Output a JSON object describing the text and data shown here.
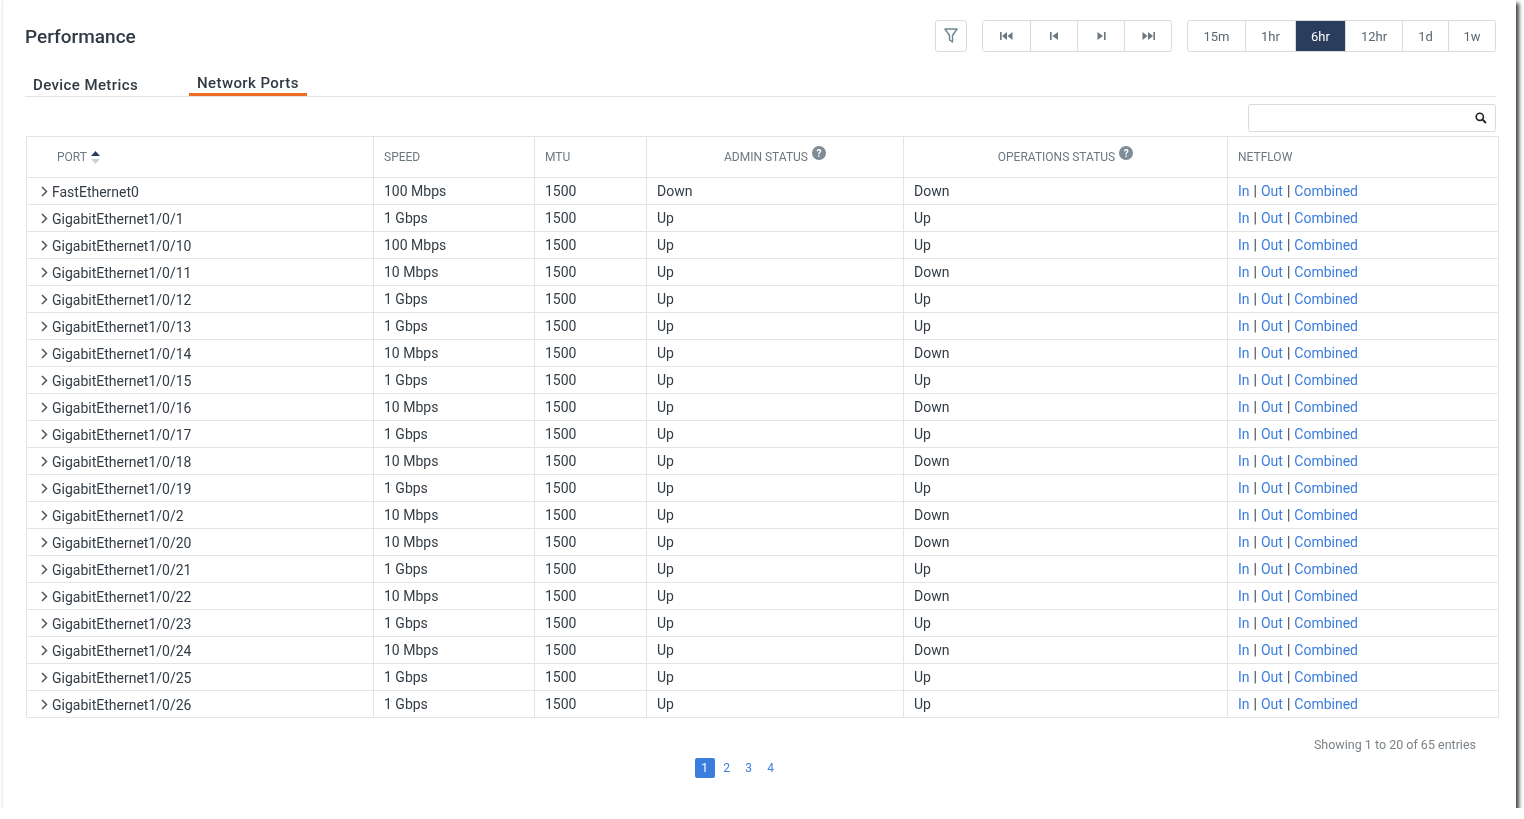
{
  "title": "Performance",
  "toolbar": {
    "nav_buttons": [
      {
        "kind": "first"
      },
      {
        "kind": "prev"
      },
      {
        "kind": "next"
      },
      {
        "kind": "last"
      }
    ],
    "ranges": [
      {
        "label": "15m",
        "selected": false
      },
      {
        "label": "1hr",
        "selected": false
      },
      {
        "label": "6hr",
        "selected": true
      },
      {
        "label": "12hr",
        "selected": false
      },
      {
        "label": "1d",
        "selected": false
      },
      {
        "label": "1w",
        "selected": false
      }
    ]
  },
  "tabs": [
    {
      "label": "Device Metrics",
      "selected": false
    },
    {
      "label": "Network Ports",
      "selected": true
    }
  ],
  "table": {
    "columns": [
      {
        "label": "PORT",
        "sorted": true
      },
      {
        "label": "SPEED",
        "sorted": false
      },
      {
        "label": "MTU",
        "sorted": false
      },
      {
        "label": "ADMIN STATUS",
        "sorted": false,
        "help": "?"
      },
      {
        "label": "OPERATIONS STATUS",
        "sorted": false,
        "help": "?"
      },
      {
        "label": "NETFLOW",
        "sorted": false
      }
    ],
    "rows": [
      {
        "port": "FastEthernet0",
        "speed": "100 Mbps",
        "mtu": "1500",
        "admin": "Down",
        "ops": "Down",
        "expanded": false,
        "netflow": [
          "In",
          "|",
          "Out",
          "|",
          "Combined"
        ]
      },
      {
        "port": "GigabitEthernet1/0/1",
        "speed": "1 Gbps",
        "mtu": "1500",
        "admin": "Up",
        "ops": "Up",
        "expanded": false,
        "netflow": [
          "In",
          "|",
          "Out",
          "|",
          "Combined"
        ]
      },
      {
        "port": "GigabitEthernet1/0/10",
        "speed": "100 Mbps",
        "mtu": "1500",
        "admin": "Up",
        "ops": "Up",
        "expanded": false,
        "netflow": [
          "In",
          "|",
          "Out",
          "|",
          "Combined"
        ]
      },
      {
        "port": "GigabitEthernet1/0/11",
        "speed": "10 Mbps",
        "mtu": "1500",
        "admin": "Up",
        "ops": "Down",
        "expanded": false,
        "netflow": [
          "In",
          "|",
          "Out",
          "|",
          "Combined"
        ]
      },
      {
        "port": "GigabitEthernet1/0/12",
        "speed": "1 Gbps",
        "mtu": "1500",
        "admin": "Up",
        "ops": "Up",
        "expanded": false,
        "netflow": [
          "In",
          "|",
          "Out",
          "|",
          "Combined"
        ]
      },
      {
        "port": "GigabitEthernet1/0/13",
        "speed": "1 Gbps",
        "mtu": "1500",
        "admin": "Up",
        "ops": "Up",
        "expanded": false,
        "netflow": [
          "In",
          "|",
          "Out",
          "|",
          "Combined"
        ]
      },
      {
        "port": "GigabitEthernet1/0/14",
        "speed": "10 Mbps",
        "mtu": "1500",
        "admin": "Up",
        "ops": "Down",
        "expanded": false,
        "netflow": [
          "In",
          "|",
          "Out",
          "|",
          "Combined"
        ]
      },
      {
        "port": "GigabitEthernet1/0/15",
        "speed": "1 Gbps",
        "mtu": "1500",
        "admin": "Up",
        "ops": "Up",
        "expanded": false,
        "netflow": [
          "In",
          "|",
          "Out",
          "|",
          "Combined"
        ]
      },
      {
        "port": "GigabitEthernet1/0/16",
        "speed": "10 Mbps",
        "mtu": "1500",
        "admin": "Up",
        "ops": "Down",
        "expanded": false,
        "netflow": [
          "In",
          "|",
          "Out",
          "|",
          "Combined"
        ]
      },
      {
        "port": "GigabitEthernet1/0/17",
        "speed": "1 Gbps",
        "mtu": "1500",
        "admin": "Up",
        "ops": "Up",
        "expanded": false,
        "netflow": [
          "In",
          "|",
          "Out",
          "|",
          "Combined"
        ]
      },
      {
        "port": "GigabitEthernet1/0/18",
        "speed": "10 Mbps",
        "mtu": "1500",
        "admin": "Up",
        "ops": "Down",
        "expanded": false,
        "netflow": [
          "In",
          "|",
          "Out",
          "|",
          "Combined"
        ]
      },
      {
        "port": "GigabitEthernet1/0/19",
        "speed": "1 Gbps",
        "mtu": "1500",
        "admin": "Up",
        "ops": "Up",
        "expanded": false,
        "netflow": [
          "In",
          "|",
          "Out",
          "|",
          "Combined"
        ]
      },
      {
        "port": "GigabitEthernet1/0/2",
        "speed": "10 Mbps",
        "mtu": "1500",
        "admin": "Up",
        "ops": "Down",
        "expanded": false,
        "netflow": [
          "In",
          "|",
          "Out",
          "|",
          "Combined"
        ]
      },
      {
        "port": "GigabitEthernet1/0/20",
        "speed": "10 Mbps",
        "mtu": "1500",
        "admin": "Up",
        "ops": "Down",
        "expanded": false,
        "netflow": [
          "In",
          "|",
          "Out",
          "|",
          "Combined"
        ]
      },
      {
        "port": "GigabitEthernet1/0/21",
        "speed": "1 Gbps",
        "mtu": "1500",
        "admin": "Up",
        "ops": "Up",
        "expanded": false,
        "netflow": [
          "In",
          "|",
          "Out",
          "|",
          "Combined"
        ]
      },
      {
        "port": "GigabitEthernet1/0/22",
        "speed": "10 Mbps",
        "mtu": "1500",
        "admin": "Up",
        "ops": "Down",
        "expanded": false,
        "netflow": [
          "In",
          "|",
          "Out",
          "|",
          "Combined"
        ]
      },
      {
        "port": "GigabitEthernet1/0/23",
        "speed": "1 Gbps",
        "mtu": "1500",
        "admin": "Up",
        "ops": "Up",
        "expanded": false,
        "netflow": [
          "In",
          "|",
          "Out",
          "|",
          "Combined"
        ]
      },
      {
        "port": "GigabitEthernet1/0/24",
        "speed": "10 Mbps",
        "mtu": "1500",
        "admin": "Up",
        "ops": "Down",
        "expanded": false,
        "netflow": [
          "In",
          "|",
          "Out",
          "|",
          "Combined"
        ]
      },
      {
        "port": "GigabitEthernet1/0/25",
        "speed": "1 Gbps",
        "mtu": "1500",
        "admin": "Up",
        "ops": "Up",
        "expanded": false,
        "netflow": [
          "In",
          "|",
          "Out",
          "|",
          "Combined"
        ]
      },
      {
        "port": "GigabitEthernet1/0/26",
        "speed": "1 Gbps",
        "mtu": "1500",
        "admin": "Up",
        "ops": "Up",
        "expanded": false,
        "netflow": [
          "In",
          "|",
          "Out",
          "|",
          "Combined"
        ]
      }
    ]
  },
  "entries_info": "Showing 1 to 20 of 65 entries",
  "pages": [
    {
      "label": "1",
      "selected": true
    },
    {
      "label": "2",
      "selected": false
    },
    {
      "label": "3",
      "selected": false
    },
    {
      "label": "4",
      "selected": false
    }
  ]
}
